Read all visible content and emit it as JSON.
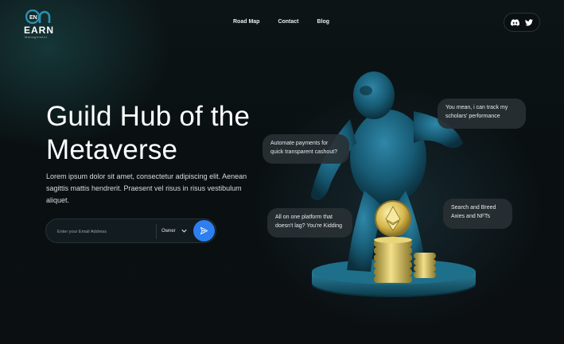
{
  "brand": {
    "mark": "EN",
    "name": "EARN",
    "tagline": "Management"
  },
  "nav": {
    "items": [
      {
        "label": "Road Map"
      },
      {
        "label": "Contact"
      },
      {
        "label": "Blog"
      }
    ]
  },
  "social": {
    "icons": [
      "discord-icon",
      "twitter-icon"
    ]
  },
  "hero": {
    "title": "Guild Hub of the Metaverse",
    "description": "Lorem ipsum dolor sit amet, consectetur adipiscing elit. Aenean sagittis mattis hendrerit. Praesent vel risus in risus vestibulum aliquet."
  },
  "form": {
    "email_placeholder": "Enter your Email Address",
    "role_value": "Owner",
    "submit_icon": "send-icon"
  },
  "bubbles": {
    "automate": "Automate payments for quick transparent cashout?",
    "track": "You mean, i can track my scholars' performance",
    "platform": "All on one platform that doesn't lag? You're Kidding",
    "breed": "Search and Breed Axies and NFTs"
  },
  "colors": {
    "accent": "#2d7ff0",
    "brand_teal": "#1f6f8b",
    "background": "#0b1013"
  }
}
